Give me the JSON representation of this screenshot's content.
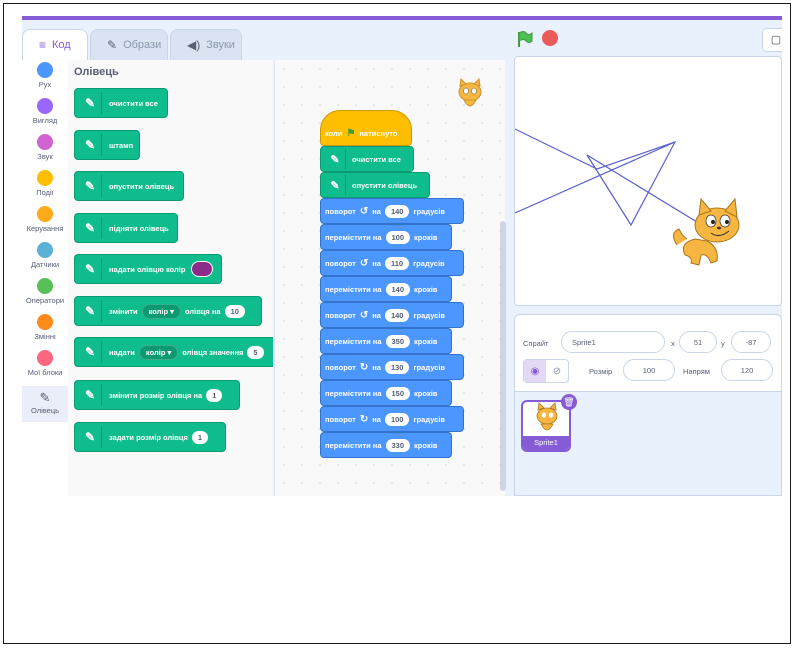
{
  "tabs": [
    {
      "label": "Код",
      "icon": "code-icon"
    },
    {
      "label": "Образи",
      "icon": "costume-brush-icon"
    },
    {
      "label": "Звуки",
      "icon": "speaker-icon"
    }
  ],
  "categories": [
    {
      "label": "Рух",
      "color": "#4c97ff"
    },
    {
      "label": "Вигляд",
      "color": "#9966ff"
    },
    {
      "label": "Звук",
      "color": "#cf63cf"
    },
    {
      "label": "Події",
      "color": "#ffbf00"
    },
    {
      "label": "Керування",
      "color": "#ffab19"
    },
    {
      "label": "Датчики",
      "color": "#5cb1d6"
    },
    {
      "label": "Оператори",
      "color": "#59c059"
    },
    {
      "label": "Змінні",
      "color": "#ff8c1a"
    },
    {
      "label": "Мої блоки",
      "color": "#ff6680"
    },
    {
      "label": "Олівець",
      "color": "#0fbd8c"
    }
  ],
  "palette": {
    "title": "Олівець",
    "blocks": {
      "clear": "очистити все",
      "stamp": "штамп",
      "pen_down": "опустити олівець",
      "pen_up": "підняти олівець",
      "set_color": "надати олівцю колір",
      "change_a": "змінити",
      "change_dd": "колір",
      "change_b": "олівця на",
      "change_val": "10",
      "set_a": "надати",
      "set_dd": "колір",
      "set_b": "олівця значення",
      "set_val": "5",
      "change_size": "змінити розмір олівця на",
      "change_size_val": "1",
      "set_size": "задати розмір олівця",
      "set_size_val": "1"
    }
  },
  "script": {
    "hat": {
      "a": "коли",
      "b": "натиснуто"
    },
    "clear": "очистити все",
    "pen_down": "опустити олівець",
    "turn_word": "поворот",
    "on_word": "на",
    "deg_word": "градусів",
    "move_word": "перемістити на",
    "steps_word": "кроків",
    "steps": [
      {
        "kind": "turn",
        "dir": "ccw",
        "value": "140"
      },
      {
        "kind": "move",
        "value": "100"
      },
      {
        "kind": "turn",
        "dir": "ccw",
        "value": "110"
      },
      {
        "kind": "move",
        "value": "140"
      },
      {
        "kind": "turn",
        "dir": "ccw",
        "value": "140"
      },
      {
        "kind": "move",
        "value": "350"
      },
      {
        "kind": "turn",
        "dir": "cw",
        "value": "130"
      },
      {
        "kind": "move",
        "value": "150"
      },
      {
        "kind": "turn",
        "dir": "cw",
        "value": "100"
      },
      {
        "kind": "move",
        "value": "330"
      }
    ]
  },
  "sprite_info": {
    "sprite_label": "Спрайт",
    "sprite_name": "Sprite1",
    "x_label": "x",
    "x_value": "51",
    "y_label": "y",
    "y_value": "-87",
    "size_label": "Розмір",
    "size_value": "100",
    "direction_label": "Напрям",
    "direction_value": "120"
  },
  "sprite_list": [
    {
      "name": "Sprite1"
    }
  ],
  "colors": {
    "accent": "#855cd6",
    "pen": "#0fbd8c",
    "motion": "#4c97ff",
    "events": "#ffbf00",
    "pen_color": "#8b2a8b"
  }
}
